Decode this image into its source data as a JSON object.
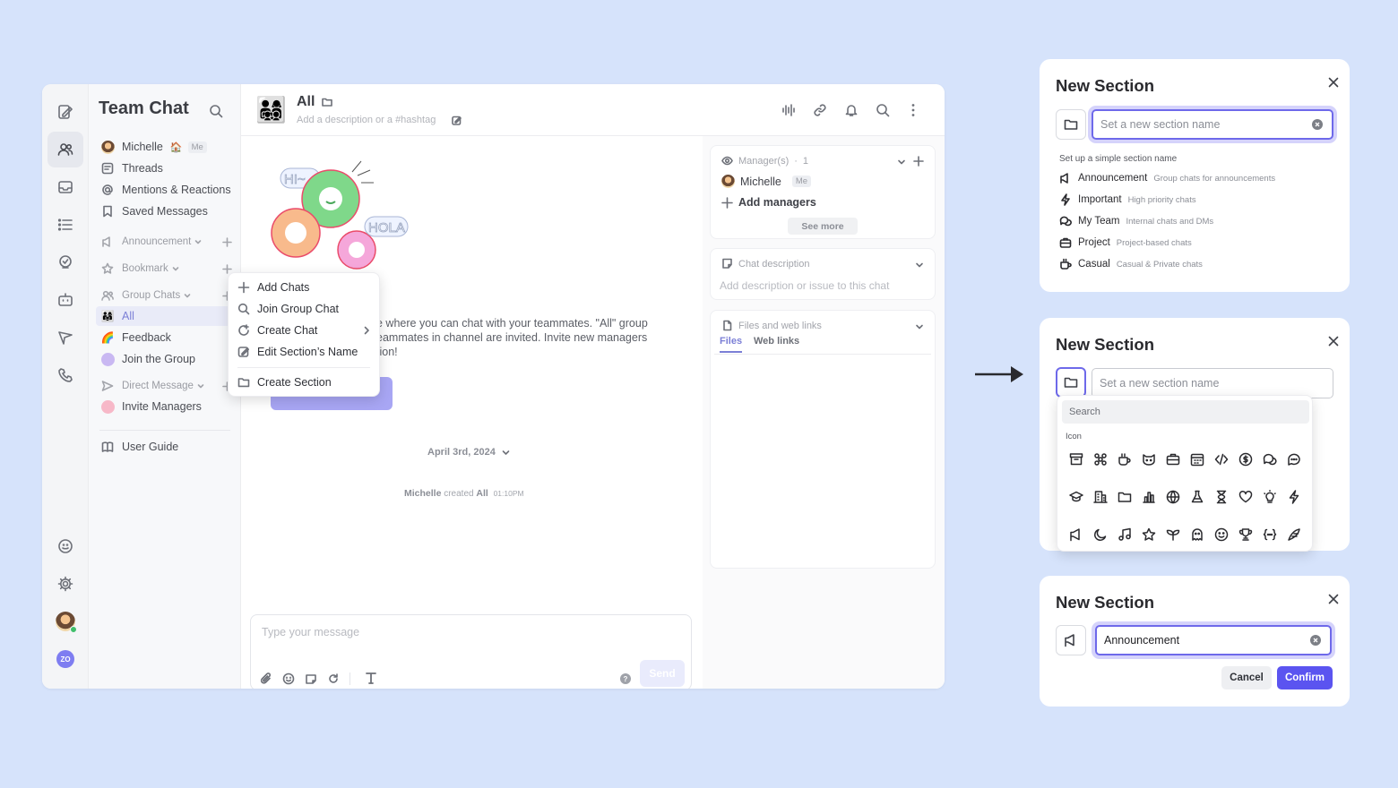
{
  "app": {
    "title": "Team Chat",
    "sidebar": {
      "user_name": "Michelle",
      "me_badge": "Me",
      "items": [
        {
          "label": "Threads"
        },
        {
          "label": "Mentions & Reactions"
        },
        {
          "label": "Saved Messages"
        }
      ],
      "section_announcement": "Announcement",
      "section_bookmark": "Bookmark",
      "section_group_chats": "Group Chats",
      "group_chats": [
        {
          "label": "All"
        },
        {
          "label": "Feedback"
        },
        {
          "label": "Join the Group"
        }
      ],
      "section_direct": "Direct Message",
      "direct": [
        {
          "label": "Invite Managers"
        }
      ],
      "user_guide": "User Guide"
    },
    "chat": {
      "title": "All",
      "description_placeholder": "Add a description or a #hashtag",
      "welcome_line1": "e where you can chat with your teammates. \"All\" group",
      "welcome_line2": "eammates in channel are invited. Invite new managers",
      "welcome_line3": "tion!",
      "bubble_hi": "HI~",
      "bubble_hola": "HOLA",
      "date": "April 3rd, 2024",
      "created_user": "Michelle",
      "created_text": "created",
      "created_chat": "All",
      "created_time": "01:10PM",
      "composer_placeholder": "Type your message",
      "send_label": "Send"
    },
    "context_menu": {
      "items": [
        {
          "label": "Add Chats"
        },
        {
          "label": "Join Group Chat"
        },
        {
          "label": "Create Chat"
        },
        {
          "label": "Edit Section’s Name"
        },
        {
          "label": "Create Section"
        }
      ]
    },
    "right_panel": {
      "managers_header": "Manager(s)",
      "managers_count": "1",
      "manager_name": "Michelle",
      "manager_badge": "Me",
      "add_managers": "Add managers",
      "see_more": "See more",
      "chat_description_header": "Chat description",
      "chat_description_placeholder": "Add description or issue to this chat",
      "files_header": "Files and web links",
      "tab_files": "Files",
      "tab_web_links": "Web links"
    }
  },
  "dialogs": {
    "title": "New Section",
    "input_placeholder": "Set a new section name",
    "suggestions_title": "Set up a simple section name",
    "suggestions": [
      {
        "name": "Announcement",
        "desc": "Group chats for announcements",
        "icon": "megaphone-icon"
      },
      {
        "name": "Important",
        "desc": "High priority chats",
        "icon": "lightning-icon"
      },
      {
        "name": "My Team",
        "desc": "Internal chats and DMs",
        "icon": "chat-bubbles-icon"
      },
      {
        "name": "Project",
        "desc": "Project-based chats",
        "icon": "briefcase-icon"
      },
      {
        "name": "Casual",
        "desc": "Casual & Private chats",
        "icon": "coffee-icon"
      }
    ],
    "picker_search": "Search",
    "picker_label": "Icon",
    "input_value": "Announcement",
    "cancel_label": "Cancel",
    "confirm_label": "Confirm"
  },
  "colors": {
    "accent": "#5b54f0",
    "background": "#d6e3fb"
  }
}
